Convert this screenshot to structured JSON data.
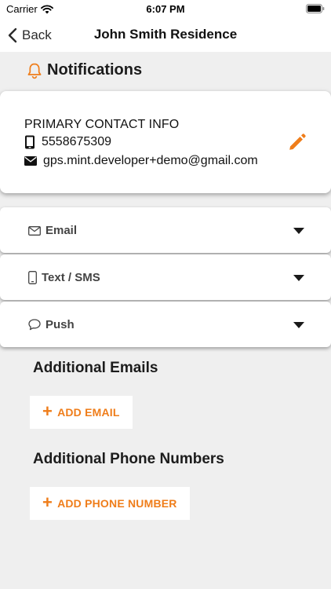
{
  "status_bar": {
    "carrier": "Carrier",
    "time": "6:07 PM"
  },
  "nav": {
    "back_label": "Back",
    "title": "John Smith Residence"
  },
  "notifications": {
    "title": "Notifications"
  },
  "primary_contact": {
    "title": "PRIMARY CONTACT INFO",
    "phone": "5558675309",
    "email": "gps.mint.developer+demo@gmail.com"
  },
  "channels": [
    {
      "label": "Email",
      "icon": "envelope-icon"
    },
    {
      "label": "Text / SMS",
      "icon": "phone-icon"
    },
    {
      "label": "Push",
      "icon": "speech-bubble-icon"
    }
  ],
  "additional_emails": {
    "title": "Additional Emails",
    "button_label": "ADD EMAIL"
  },
  "additional_phones": {
    "title": "Additional Phone Numbers",
    "button_label": "ADD PHONE NUMBER"
  },
  "colors": {
    "accent": "#ef7d1a",
    "background": "#efefef",
    "card": "#ffffff"
  }
}
